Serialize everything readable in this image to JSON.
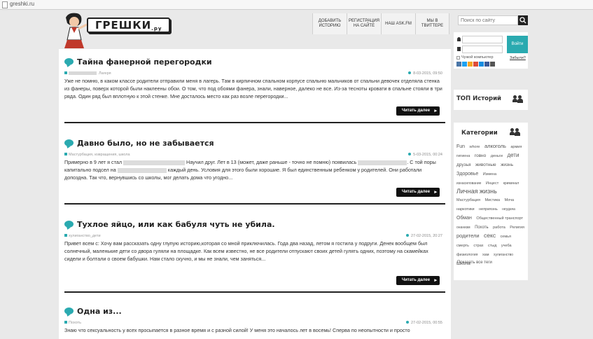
{
  "browser": {
    "url": "greshki.ru"
  },
  "logo": {
    "text": "ГРЕШКИ",
    "suffix": ".ру"
  },
  "topnav": [
    {
      "label": "Добавить историю"
    },
    {
      "label": "Регистрация на сайте"
    },
    {
      "label": "Наш ask.fm"
    },
    {
      "label": "Мы в твиттере"
    }
  ],
  "search": {
    "placeholder": "Поиск по сайту"
  },
  "posts": [
    {
      "title": "Тайна фанерной перегородки",
      "category": "Лагеря",
      "date": "8-03-2015, 09:50",
      "text": "Уже не помню, в каком классе родители отправили меня в лагерь. Там в кирпичном спальном корпусе спальню мальчиков от спальни девочек отделяла стенка из фанеры, поверх которой были наклеены обои. О том, что под обоями фанера, знали, наверное, далеко не все. Из-за тесноты кровати в спальне стояли в три ряда. Один ряд был вплотную к этой стенке. Мне досталось место как раз возле перегородки...",
      "more": "Читать далее"
    },
    {
      "title": "Давно было, но не забывается",
      "category": "Мастурбация, извращения, школа",
      "date": "5-03-2015, 00:24",
      "text_a": "Примерно в 9 лет я стал",
      "text_b": "Научил друг. Лет в 13 (может, даже раньше - точно не помню) появилась",
      "text_c": ". С той поры капитально подсел на",
      "text_d": "каждый день. Условия для этого были хорошие. Я был единственным ребенком у родителей. Они работали допоздна. Так что, вернувшись со школы, мог делать дома что угодно...",
      "more": "Читать далее"
    },
    {
      "title": "Тухлое яйцо, или как бабуля чуть не убила.",
      "category": "хулиганство_дети",
      "date": "27-02-2015, 20:27",
      "text": "Привет всем с: Хочу вам рассказать одну глупую историю,которая со мной приключилась. Года два назад, летом я гостила у подруги. Денек вообщем был солнечный, маленькие дети со двора гуляли на площадке. Как всем известно, не все родители отпускают своих детей гулять одних, поэтому на скамейках сидели и болтали о своем бабушки. Нам стало скучно, и мы не знали, чем заняться...",
      "more": "Читать далее"
    },
    {
      "title": "Одна из...",
      "category": "Похоть",
      "date": "27-02-2015, 00:55",
      "text": "Знаю что сексуальность у всех просыпается в разное время и с разной силой! У меня это началось лет в восемь! Сперва по неопытности и просто"
    }
  ],
  "login": {
    "button": "Войти",
    "remember": "Чужой компьютер",
    "forgot": "Забыли?"
  },
  "sidebar": {
    "top_title": "ТОП Историй",
    "categories_title": "Категории",
    "show_all": "Показать все теги",
    "tags": [
      {
        "t": "Fun",
        "s": 7
      },
      {
        "t": "whore",
        "s": 5.5
      },
      {
        "t": "алкоголь",
        "s": 7.5
      },
      {
        "t": "армия",
        "s": 5.5
      },
      {
        "t": "гигиена",
        "s": 5.5
      },
      {
        "t": "говно",
        "s": 6.5
      },
      {
        "t": "деньги",
        "s": 5.5
      },
      {
        "t": "дети",
        "s": 8
      },
      {
        "t": "друзья",
        "s": 6.5
      },
      {
        "t": "животные",
        "s": 6.5
      },
      {
        "t": "жизнь",
        "s": 6.5
      },
      {
        "t": "Здоровье",
        "s": 7
      },
      {
        "t": "Измена",
        "s": 5.5
      },
      {
        "t": "изнасилование",
        "s": 5
      },
      {
        "t": "Инцест",
        "s": 5.5
      },
      {
        "t": "криминал",
        "s": 5
      },
      {
        "t": "Личная жизнь",
        "s": 9
      },
      {
        "t": "Мастурбация",
        "s": 5.5
      },
      {
        "t": "Мистика",
        "s": 5.5
      },
      {
        "t": "Моча",
        "s": 5.5
      },
      {
        "t": "наркотики",
        "s": 5.5
      },
      {
        "t": "неприязнь",
        "s": 5.5
      },
      {
        "t": "неудача",
        "s": 5
      },
      {
        "t": "Обман",
        "s": 7
      },
      {
        "t": "Общественный транспорт",
        "s": 5.5
      },
      {
        "t": "онанизм",
        "s": 5
      },
      {
        "t": "Похоть",
        "s": 6
      },
      {
        "t": "работа",
        "s": 5.5
      },
      {
        "t": "Религия",
        "s": 5.5
      },
      {
        "t": "родители",
        "s": 7.5
      },
      {
        "t": "секс",
        "s": 8.5
      },
      {
        "t": "семья",
        "s": 5.5
      },
      {
        "t": "смерть",
        "s": 5.5
      },
      {
        "t": "страх",
        "s": 5.5
      },
      {
        "t": "стыд",
        "s": 5.5
      },
      {
        "t": "учеба",
        "s": 5.5
      },
      {
        "t": "физиология",
        "s": 5.5
      },
      {
        "t": "хам",
        "s": 5.5
      },
      {
        "t": "хулиганство",
        "s": 5
      },
      {
        "t": "Школа",
        "s": 6.5
      }
    ]
  },
  "colors": {
    "accent": "#2aaab0",
    "button_dark": "#111111",
    "background": "#e9e9e9"
  }
}
